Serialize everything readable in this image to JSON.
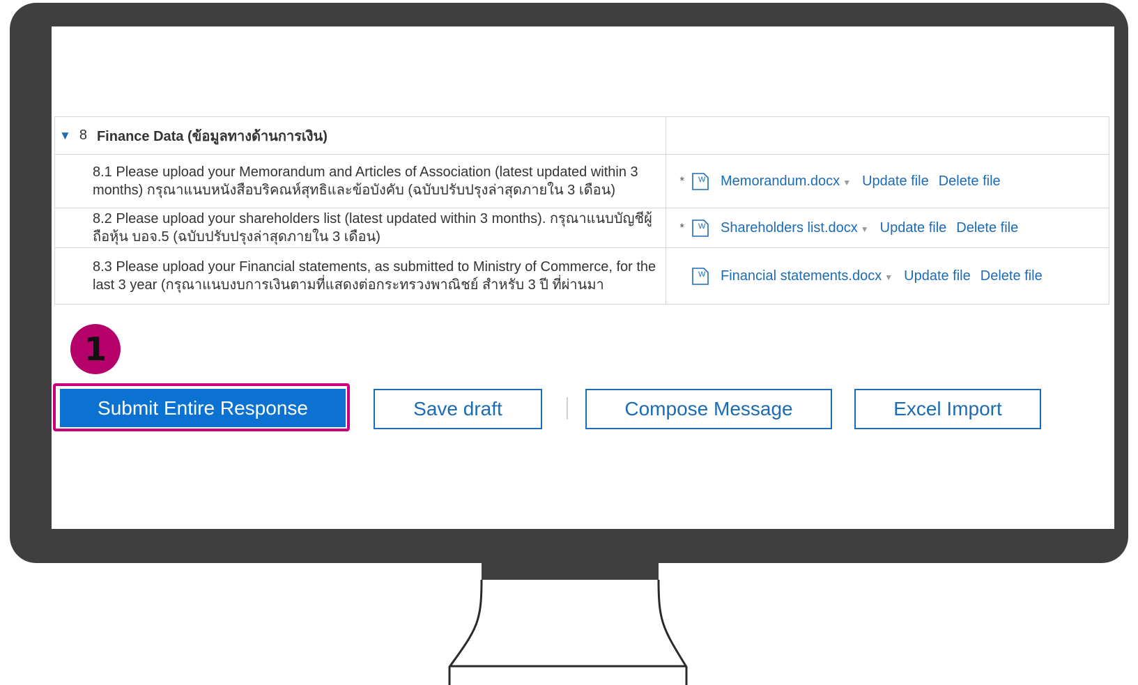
{
  "section": {
    "number": "8",
    "title": "Finance Data (ข้อมูลทางด้านการเงิน)"
  },
  "questions": [
    {
      "text": "8.1  Please upload your Memorandum and Articles of Association (latest updated within 3 months) กรุณาแนบหนังสือบริคณห์สุทธิและข้อบังคับ (ฉบับปรับปรุงล่าสุดภายใน 3 เดือน)",
      "required": "*",
      "file": "Memorandum.docx",
      "update": "Update file",
      "delete": "Delete file"
    },
    {
      "text": "8.2  Please upload your shareholders list  (latest updated within 3 months). กรุณาแนบบัญชีผู้ถือหุ้น บอจ.5 (ฉบับปรับปรุงล่าสุดภายใน 3 เดือน)",
      "required": "*",
      "file": "Shareholders list.docx",
      "update": "Update file",
      "delete": "Delete file"
    },
    {
      "text": "8.3  Please upload your Financial statements, as submitted to Ministry of Commerce, for the last 3 year (กรุณาแนบงบการเงินตามที่แสดงต่อกระทรวงพาณิชย์ สำหรับ 3 ปี ที่ผ่านมา",
      "required": "",
      "file": "Financial statements.docx",
      "update": "Update file",
      "delete": "Delete file"
    }
  ],
  "step_badge": "1",
  "buttons": {
    "submit": "Submit Entire Response",
    "save_draft": "Save draft",
    "compose": "Compose Message",
    "excel_import": "Excel Import"
  },
  "colors": {
    "primary": "#0b72d2",
    "link": "#1b6bb6",
    "highlight": "#c8007a",
    "badge": "#b5006a",
    "monitor": "#3f3f3f"
  }
}
